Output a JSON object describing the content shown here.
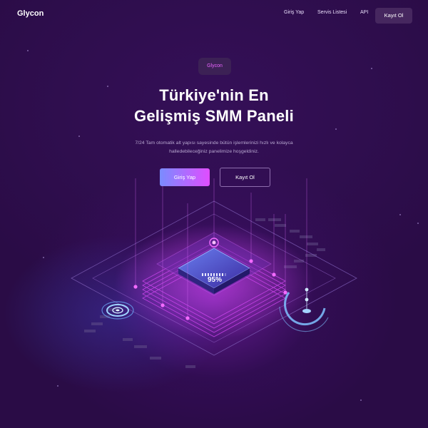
{
  "brand": {
    "logo": "Glycon"
  },
  "nav": {
    "links": [
      "Giriş Yap",
      "Servis Listesi",
      "API"
    ],
    "cta": "Kayıt Ol"
  },
  "hero": {
    "badge": "Glycon",
    "title_line1": "Türkiye'nin En",
    "title_line2": "Gelişmiş SMM Paneli",
    "desc_line1": "7/24 Tam otomatik alt yapısı sayesinde bütün işlemlerinizi hızlı ve kolayca",
    "desc_line2": "halledebileceğiniz panelimize hoşgeldiniz.",
    "primary_button": "Giriş Yap",
    "secondary_button": "Kayıt Ol"
  },
  "illustration": {
    "progress_label": "95%",
    "progress_value": 0.95
  },
  "colors": {
    "background": "#2a0c46",
    "accent_pink": "#e04dff",
    "accent_blue": "#7a8cff"
  }
}
